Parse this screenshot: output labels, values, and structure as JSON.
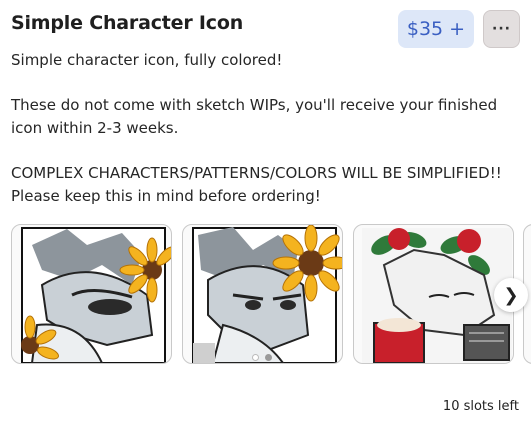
{
  "listing": {
    "title": "Simple Character Icon",
    "price": "$35 +",
    "more_label": "···",
    "description": [
      "Simple character icon, fully colored!",
      "These do not come with sketch WIPs, you'll receive your finished",
      "icon within 2-3 weeks.",
      "COMPLEX CHARACTERS/PATTERNS/COLORS WILL BE SIMPLIFIED!!",
      "Please keep this in mind before ordering!"
    ],
    "slots": "10 slots left"
  },
  "carousel": {
    "images": [
      {
        "icon": "wolf-character-sunflower-icon"
      },
      {
        "icon": "wolf-character-sunflower-grumpy-icon"
      },
      {
        "icon": "white-hair-character-roses-icon"
      }
    ],
    "next_icon": "chevron-right-icon",
    "next_glyph": "❯"
  },
  "colors": {
    "price_bg": "#dde7f8",
    "price_text": "#3a5fc2",
    "more_bg": "#e3dfdf"
  }
}
